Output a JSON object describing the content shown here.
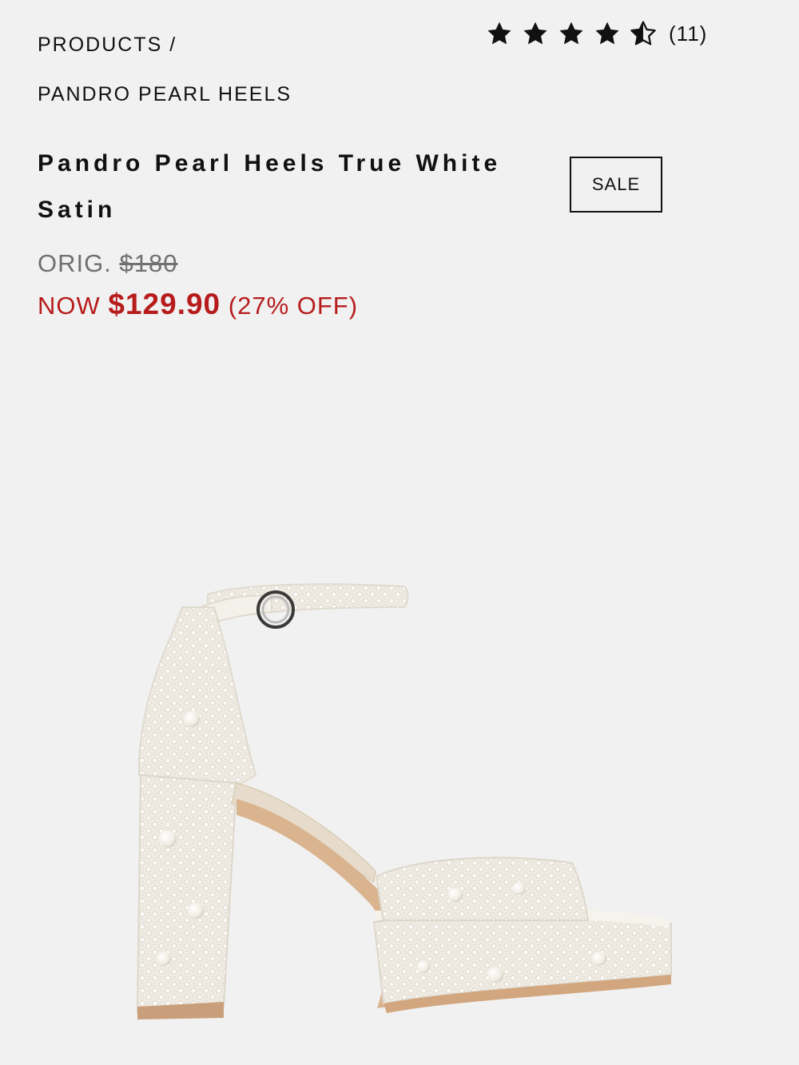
{
  "breadcrumb": {
    "root": "PRODUCTS /",
    "current": "PANDRO PEARL HEELS"
  },
  "rating": {
    "stars_value": 4.5,
    "stars_max": 5,
    "count": "(11)",
    "star_color": "#111111"
  },
  "product": {
    "title": "Pandro Pearl Heels True White Satin",
    "badge": "SALE",
    "image_icon": "pearl-platform-heel-image"
  },
  "price": {
    "orig_label": "ORIG.",
    "orig_value": "$180",
    "now_label": "NOW",
    "now_value": "$129.90",
    "discount": "(27% OFF)",
    "sale_color": "#b71c1c",
    "orig_color": "#707070"
  }
}
